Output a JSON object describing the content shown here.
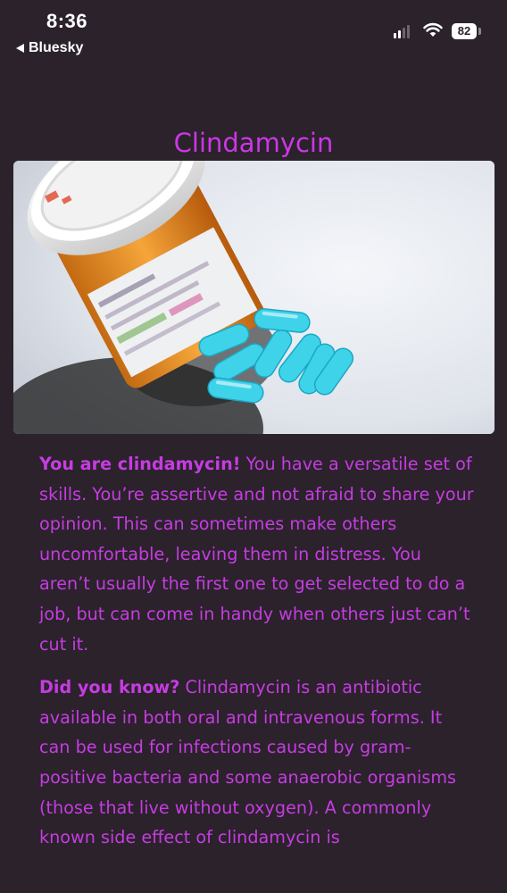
{
  "status_bar": {
    "time": "8:36",
    "back_label": "Bluesky",
    "battery_level": "82",
    "signal_bars_active": 2,
    "icons": [
      "signal-icon",
      "wifi-icon",
      "battery-icon"
    ]
  },
  "page": {
    "title": "Clindamycin",
    "image_subject": "pill bottle with blue-green capsules"
  },
  "paragraphs": [
    {
      "lead": "You are clindamycin!",
      "text": " You have a versatile set of skills. You’re assertive and not afraid to share your opinion. This can sometimes make others uncomfortable, leaving them in distress. You aren’t usually the first one to get selected to do a job, but can come in handy when others just can’t cut it."
    },
    {
      "lead": "Did you know?",
      "text": " Clindamycin is an antibiotic available in both oral and intravenous forms. It can be used for infections caused by gram-positive bacteria and some anaerobic organisms (those that live without oxygen). A commonly known side effect of clindamycin is"
    }
  ],
  "colors": {
    "background": "#2b222b",
    "accent": "#cc37e6",
    "capsule": "#3fd3ea"
  }
}
